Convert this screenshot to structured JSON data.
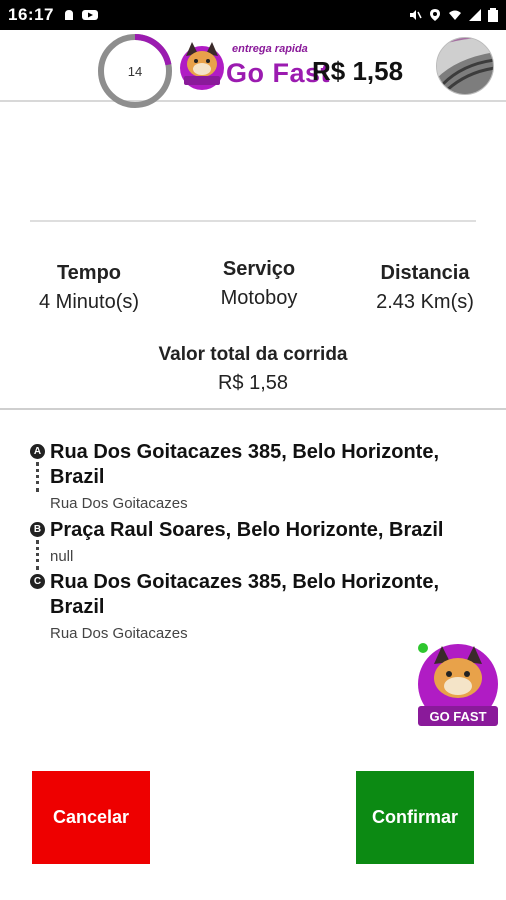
{
  "status_bar": {
    "time": "16:17",
    "left_icons": [
      "notification-icon",
      "youtube-icon"
    ],
    "right_icons": [
      "mute-icon",
      "location-icon",
      "wifi-icon",
      "signal-icon",
      "battery-icon"
    ]
  },
  "header": {
    "logo_subtitle": "entrega rapida",
    "logo_title": "Go Fast",
    "avatar": "avatar"
  },
  "summary": {
    "progress_value": "14",
    "progress_fraction": 0.22,
    "price": "R$ 1,58"
  },
  "stats": [
    {
      "label": "Tempo",
      "value": "4 Minuto(s)"
    },
    {
      "label": "Serviço",
      "value": "Motoboy"
    },
    {
      "label": "Distancia",
      "value": "2.43 Km(s)"
    }
  ],
  "total": {
    "label": "Valor total da corrida",
    "value": "R$ 1,58"
  },
  "route": [
    {
      "marker": "A",
      "address": "Rua Dos Goitacazes 385, Belo Horizonte, Brazil",
      "detail": "Rua Dos Goitacazes"
    },
    {
      "marker": "B",
      "address": "Praça Raul Soares, Belo Horizonte, Brazil",
      "detail": "null"
    },
    {
      "marker": "C",
      "address": "Rua Dos Goitacazes 385, Belo Horizonte, Brazil",
      "detail": "Rua Dos Goitacazes"
    }
  ],
  "fab": {
    "label": "GO FAST"
  },
  "actions": {
    "cancel_label": "Cancelar",
    "confirm_label": "Confirmar"
  },
  "colors": {
    "brand_purple": "#9b1bb0",
    "cancel_red": "#ee0000",
    "confirm_green": "#0c8a13",
    "progress_track": "#8e8e8e",
    "progress_fill": "#9b1bb0"
  }
}
